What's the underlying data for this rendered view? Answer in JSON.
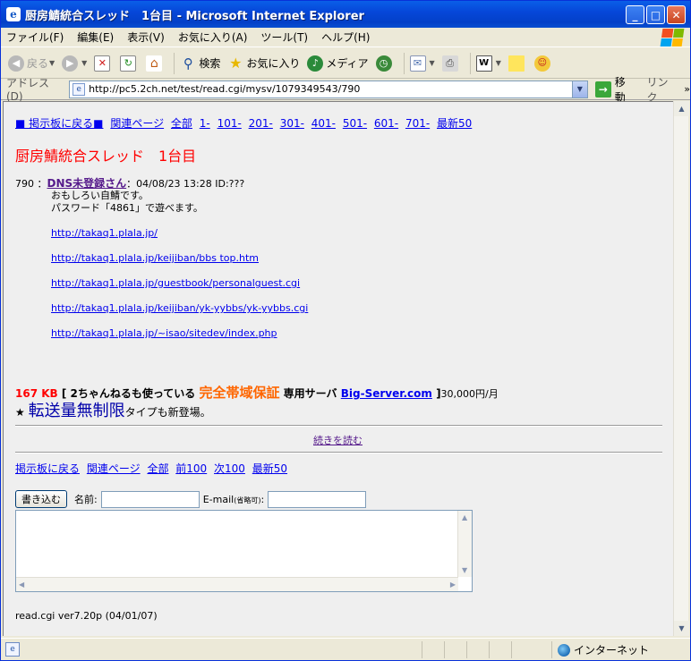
{
  "window": {
    "title": "厨房鯖統合スレッド　1台目 - Microsoft Internet Explorer"
  },
  "menu": [
    "ファイル(F)",
    "編集(E)",
    "表示(V)",
    "お気に入り(A)",
    "ツール(T)",
    "ヘルプ(H)"
  ],
  "toolbar": {
    "back": "戻る",
    "search": "検索",
    "favorites": "お気に入り",
    "media": "メディア"
  },
  "address": {
    "label": "アドレス(D)",
    "url": "http://pc5.2ch.net/test/read.cgi/mysv/1079349543/790",
    "go": "移動",
    "links": "リンク"
  },
  "nav": {
    "board_back": "■ 掲示板に戻る■",
    "related": "関連ページ",
    "all": "全部",
    "ranges": [
      "1-",
      "101-",
      "201-",
      "301-",
      "401-",
      "501-",
      "601-",
      "701-"
    ],
    "latest": "最新50"
  },
  "thread_title": "厨房鯖統合スレッド　1台目",
  "post": {
    "number": "790",
    "name": "DNS未登録さん",
    "meta": "04/08/23 13:28 ID:???",
    "lines": [
      "おもしろい自鯖です。",
      "パスワード「4861」で遊べます。"
    ],
    "links": [
      "http://takaq1.plala.jp/",
      "http://takaq1.plala.jp/keijiban/bbs top.htm",
      "http://takaq1.plala.jp/guestbook/personalguest.cgi",
      "http://takaq1.plala.jp/keijiban/yk-yybbs/yk-yybbs.cgi",
      "http://takaq1.plala.jp/~isao/sitedev/index.php"
    ]
  },
  "ad": {
    "size": "167 KB",
    "open": "[ 2ちゃんねるも使っている",
    "guarantee": "完全帯域保証",
    "server": "専用サーバ",
    "link": "Big-Server.com",
    "close": "]",
    "price": "30,000円/月",
    "star": "★",
    "unlimited": "転送量無制限",
    "tail": "タイプも新登場。"
  },
  "more": "続きを読む",
  "bottom": {
    "board_back": "掲示板に戻る",
    "related": "関連ページ",
    "all": "全部",
    "prev": "前100",
    "next": "次100",
    "latest": "最新50"
  },
  "form": {
    "submit": "書き込む",
    "name_label": "名前:",
    "email_label": "E-mail",
    "email_note": "(省略可)",
    "email_colon": ":"
  },
  "version": "read.cgi ver7.20p (04/01/07)",
  "status": {
    "zone": "インターネット"
  }
}
